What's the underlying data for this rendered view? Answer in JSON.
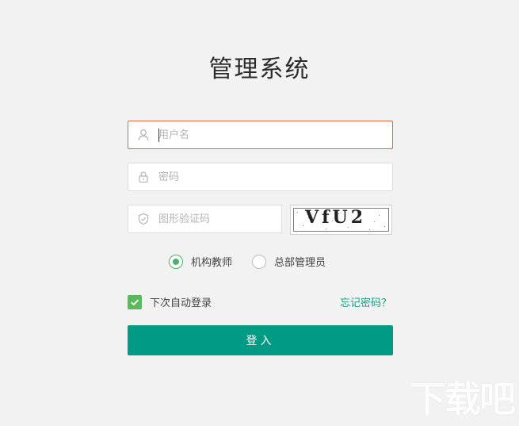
{
  "page": {
    "title": "管理系统"
  },
  "form": {
    "username": {
      "placeholder": "用户名",
      "value": "",
      "icon": "user-icon"
    },
    "password": {
      "placeholder": "密码",
      "value": "",
      "icon": "lock-icon"
    },
    "captcha": {
      "placeholder": "图形验证码",
      "value": "",
      "icon": "shield-icon",
      "image_text": "VfU2"
    },
    "roles": [
      {
        "label": "机构教师",
        "selected": true
      },
      {
        "label": "总部管理员",
        "selected": false
      }
    ],
    "remember": {
      "label": "下次自动登录",
      "checked": true
    },
    "forgot_label": "忘记密码？",
    "submit_label": "登入"
  },
  "colors": {
    "accent": "#009a85",
    "focus_border": "#e06a3a",
    "check_green": "#5cb85c",
    "link": "#1a9a83"
  },
  "watermark": "下载吧"
}
